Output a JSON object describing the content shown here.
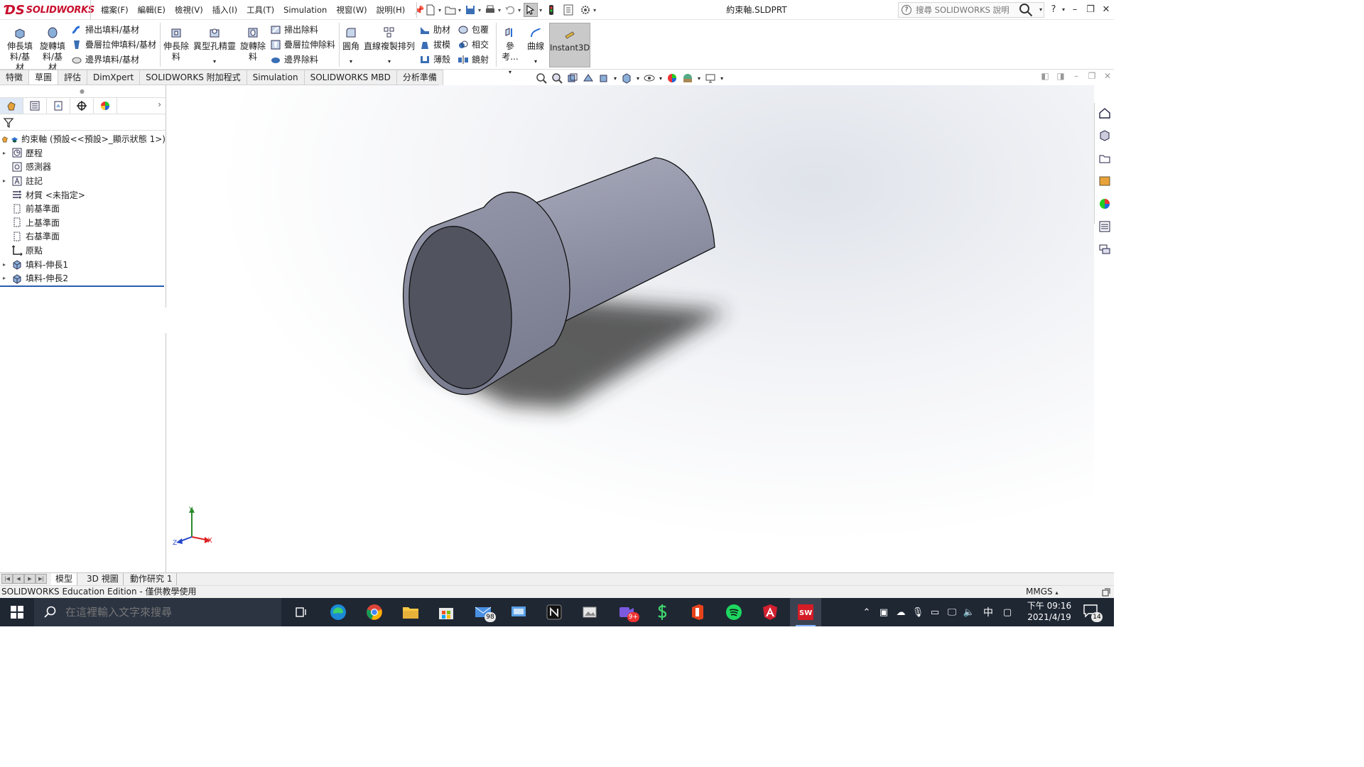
{
  "app": {
    "brand": "SOLIDWORKS",
    "document_title": "約束軸.SLDPRT"
  },
  "menu": [
    "檔案(F)",
    "編輯(E)",
    "檢視(V)",
    "插入(I)",
    "工具(T)",
    "Simulation",
    "視窗(W)",
    "說明(H)"
  ],
  "search": {
    "placeholder": "搜尋 SOLIDWORKS 說明"
  },
  "window_controls": {
    "help": "?",
    "minimize": "–",
    "restore": "❐",
    "close": "✕"
  },
  "commands": {
    "extrude_boss": "伸長填料/基材",
    "revolve_boss": "旋轉填料/基材",
    "sweep_boss": "掃出填料/基材",
    "loft_boss": "疊層拉伸填料/基材",
    "boundary_boss": "邊界填料/基材",
    "extrude_cut": "伸長除料",
    "hole_wizard": "異型孔精靈",
    "revolve_cut": "旋轉除料",
    "sweep_cut": "掃出除料",
    "loft_cut": "疊層拉伸除料",
    "boundary_cut": "邊界除料",
    "fillet": "圓角",
    "linear_pattern": "直線複製排列",
    "rib": "肋材",
    "wrap": "包覆",
    "draft": "拔模",
    "intersect": "相交",
    "shell": "薄殼",
    "mirror": "鏡射",
    "reference": "參考...",
    "curves": "曲線",
    "instant3d": "Instant3D"
  },
  "tabs": [
    "特徵",
    "草圖",
    "評估",
    "DimXpert",
    "SOLIDWORKS 附加程式",
    "Simulation",
    "SOLIDWORKS MBD",
    "分析準備"
  ],
  "tree": {
    "root": "約束軸 (預設<<預設>_顯示狀態 1>)",
    "items": [
      {
        "label": "歷程",
        "expandable": true,
        "icon": "history-icon"
      },
      {
        "label": "感測器",
        "expandable": false,
        "icon": "sensor-icon"
      },
      {
        "label": "註記",
        "expandable": true,
        "icon": "annotation-icon"
      },
      {
        "label": "材質 <未指定>",
        "expandable": false,
        "icon": "material-icon"
      },
      {
        "label": "前基準面",
        "expandable": false,
        "icon": "plane-icon"
      },
      {
        "label": "上基準面",
        "expandable": false,
        "icon": "plane-icon"
      },
      {
        "label": "右基準面",
        "expandable": false,
        "icon": "plane-icon"
      },
      {
        "label": "原點",
        "expandable": false,
        "icon": "origin-icon"
      },
      {
        "label": "填料-伸長1",
        "expandable": true,
        "icon": "extrude-feature-icon"
      },
      {
        "label": "填料-伸長2",
        "expandable": true,
        "icon": "extrude-feature-icon"
      }
    ]
  },
  "triad": {
    "x": "X",
    "y": "Y",
    "z": "Z"
  },
  "bottom_tabs": [
    "模型",
    "3D 視圖",
    "動作研究 1"
  ],
  "status": {
    "text": "SOLIDWORKS Education Edition - 僅供教學使用",
    "units": "MMGS"
  },
  "taskbar": {
    "search_placeholder": "在這裡輸入文字來搜尋",
    "mail_badge": "98",
    "meet_badge": "9+",
    "time": "下午 09:16",
    "date": "2021/4/19",
    "notifications": "14",
    "ime": "中"
  },
  "colors": {
    "brand": "#c8102e",
    "part_face": "#8c8fa3",
    "part_end_face": "#50525f",
    "taskbar_bg": "#1f2733"
  }
}
